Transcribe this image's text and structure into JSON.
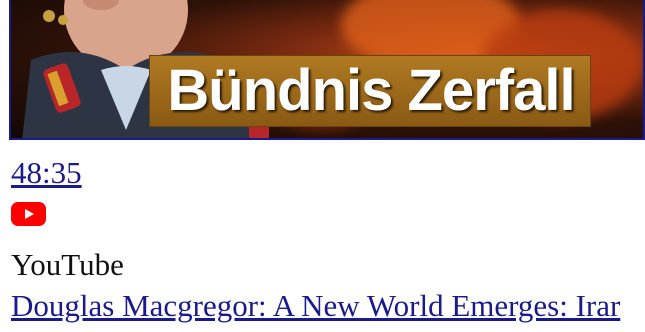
{
  "thumbnail": {
    "banner_text": "Bündnis Zerfall"
  },
  "video": {
    "duration": "48:35",
    "source_icon": "youtube-icon",
    "source": "YouTube",
    "title": "Douglas Macgregor: A New World Emerges: Irar"
  },
  "colors": {
    "link": "#1a1a8c",
    "youtube_red": "#ff0000",
    "banner_gold": "#a06e1c"
  }
}
